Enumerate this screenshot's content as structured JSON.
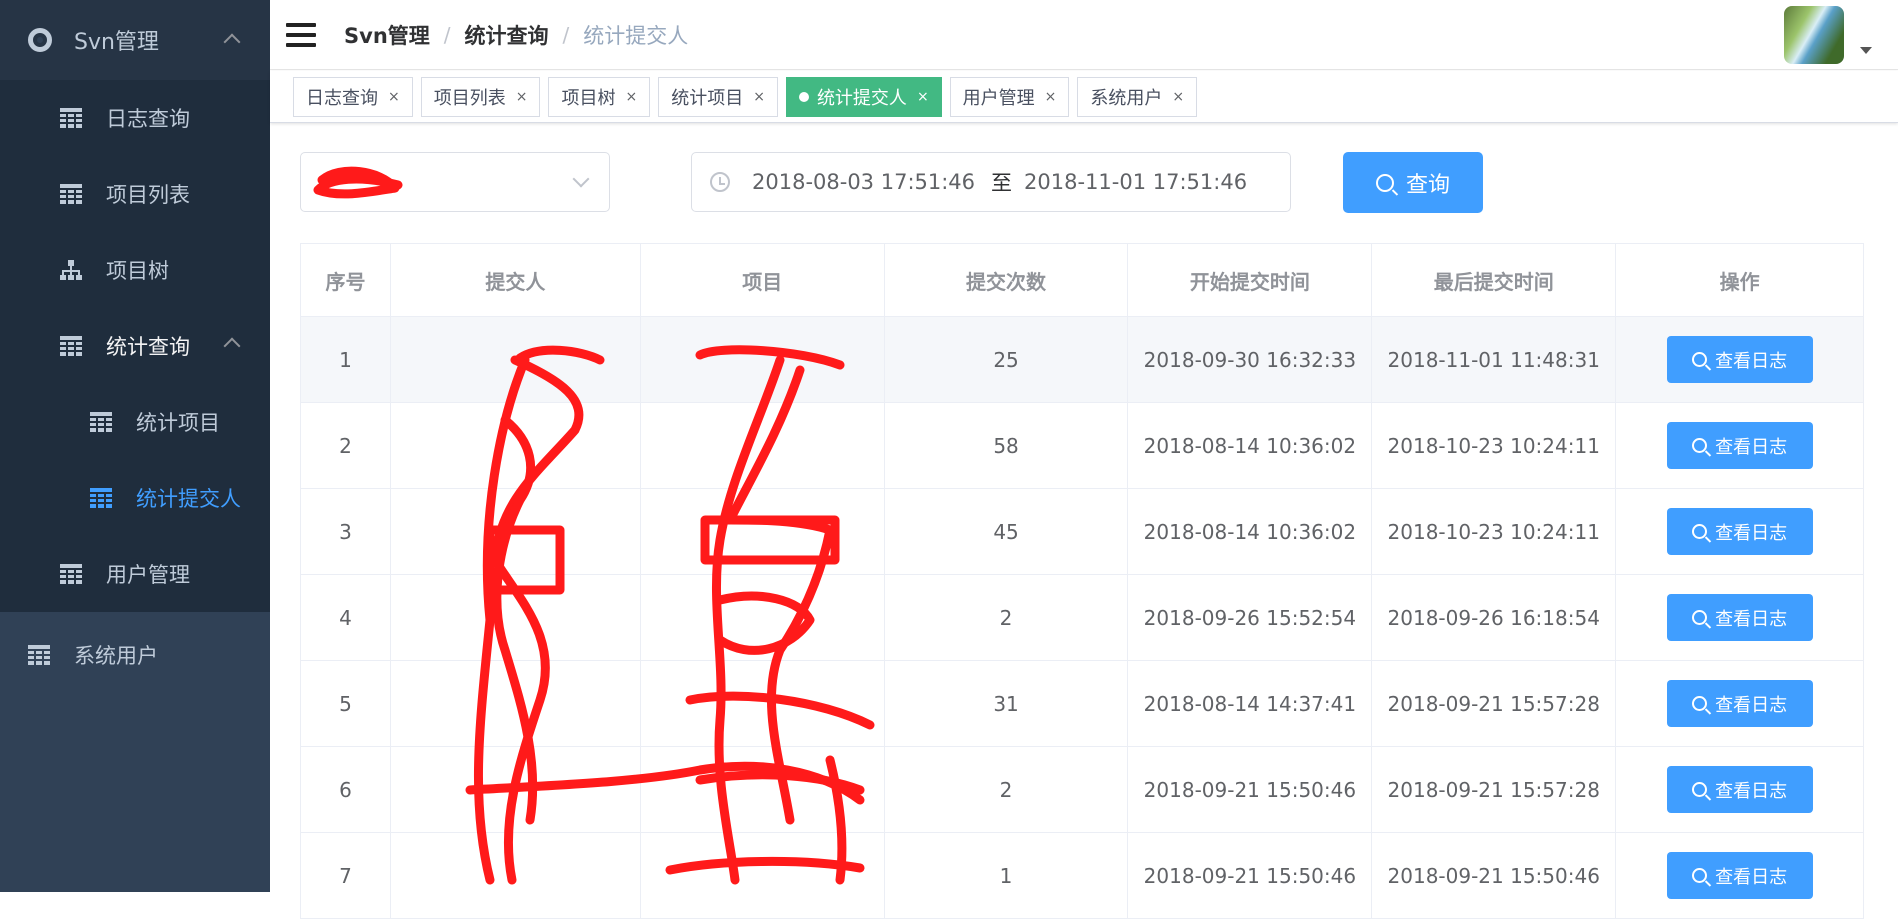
{
  "sidebar": {
    "root_label": "Svn管理",
    "items": [
      {
        "label": "日志查询",
        "icon": "table-icon"
      },
      {
        "label": "项目列表",
        "icon": "table-icon"
      },
      {
        "label": "项目树",
        "icon": "tree-icon"
      },
      {
        "label": "统计查询",
        "icon": "table-icon"
      }
    ],
    "sub_items": [
      {
        "label": "统计项目",
        "icon": "table-icon"
      },
      {
        "label": "统计提交人",
        "icon": "table-icon",
        "active": true
      }
    ],
    "user_manage": "用户管理",
    "system_user": "系统用户"
  },
  "header": {
    "breadcrumb": [
      "Svn管理",
      "统计查询",
      "统计提交人"
    ]
  },
  "tags": [
    {
      "label": "日志查询"
    },
    {
      "label": "项目列表"
    },
    {
      "label": "项目树"
    },
    {
      "label": "统计项目"
    },
    {
      "label": "统计提交人",
      "active": true
    },
    {
      "label": "用户管理"
    },
    {
      "label": "系统用户"
    }
  ],
  "tag_close": "×",
  "filters": {
    "date_start": "2018-08-03 17:51:46",
    "date_sep": "至",
    "date_end": "2018-11-01 17:51:46",
    "query_button": "查询"
  },
  "table": {
    "headers": [
      "序号",
      "提交人",
      "项目",
      "提交次数",
      "开始提交时间",
      "最后提交时间",
      "操作"
    ],
    "action_label": "查看日志",
    "rows": [
      {
        "no": "1",
        "committer": "",
        "project": "",
        "count": "25",
        "start": "2018-09-30 16:32:33",
        "last": "2018-11-01 11:48:31"
      },
      {
        "no": "2",
        "committer": "",
        "project": "",
        "count": "58",
        "start": "2018-08-14 10:36:02",
        "last": "2018-10-23 10:24:11"
      },
      {
        "no": "3",
        "committer": "",
        "project": "",
        "count": "45",
        "start": "2018-08-14 10:36:02",
        "last": "2018-10-23 10:24:11"
      },
      {
        "no": "4",
        "committer": "",
        "project": "",
        "count": "2",
        "start": "2018-09-26 15:52:54",
        "last": "2018-09-26 16:18:54"
      },
      {
        "no": "5",
        "committer": "",
        "project": "",
        "count": "31",
        "start": "2018-08-14 14:37:41",
        "last": "2018-09-21 15:57:28"
      },
      {
        "no": "6",
        "committer": "",
        "project": "",
        "count": "2",
        "start": "2018-09-21 15:50:46",
        "last": "2018-09-21 15:57:28"
      },
      {
        "no": "7",
        "committer": "",
        "project": "",
        "count": "1",
        "start": "2018-09-21 15:50:46",
        "last": "2018-09-21 15:50:46"
      }
    ]
  },
  "colors": {
    "accent": "#409eff",
    "active_tag": "#42b983",
    "sidebar": "#304156",
    "redaction": "#ff1a1a"
  }
}
